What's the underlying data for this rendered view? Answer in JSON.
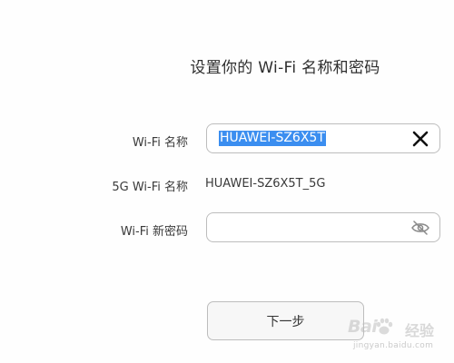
{
  "page": {
    "title": "设置你的 Wi-Fi 名称和密码"
  },
  "wifi_name": {
    "label": "Wi-Fi 名称",
    "value": "HUAWEI-SZ6X5T",
    "clear_icon": "close-icon"
  },
  "wifi_5g_name": {
    "label": "5G Wi-Fi 名称",
    "value": "HUAWEI-SZ6X5T_5G"
  },
  "wifi_password": {
    "label": "Wi-Fi 新密码",
    "value": "",
    "visibility_icon": "eye-hidden-icon"
  },
  "actions": {
    "next_label": "下一步"
  },
  "watermark": {
    "brand": "Bai",
    "brand_suffix": "经验",
    "url": "jingyan.baidu.com"
  },
  "colors": {
    "selection_highlight": "#3b8ef0",
    "field_border": "#bdbdbd",
    "text": "#333333"
  }
}
